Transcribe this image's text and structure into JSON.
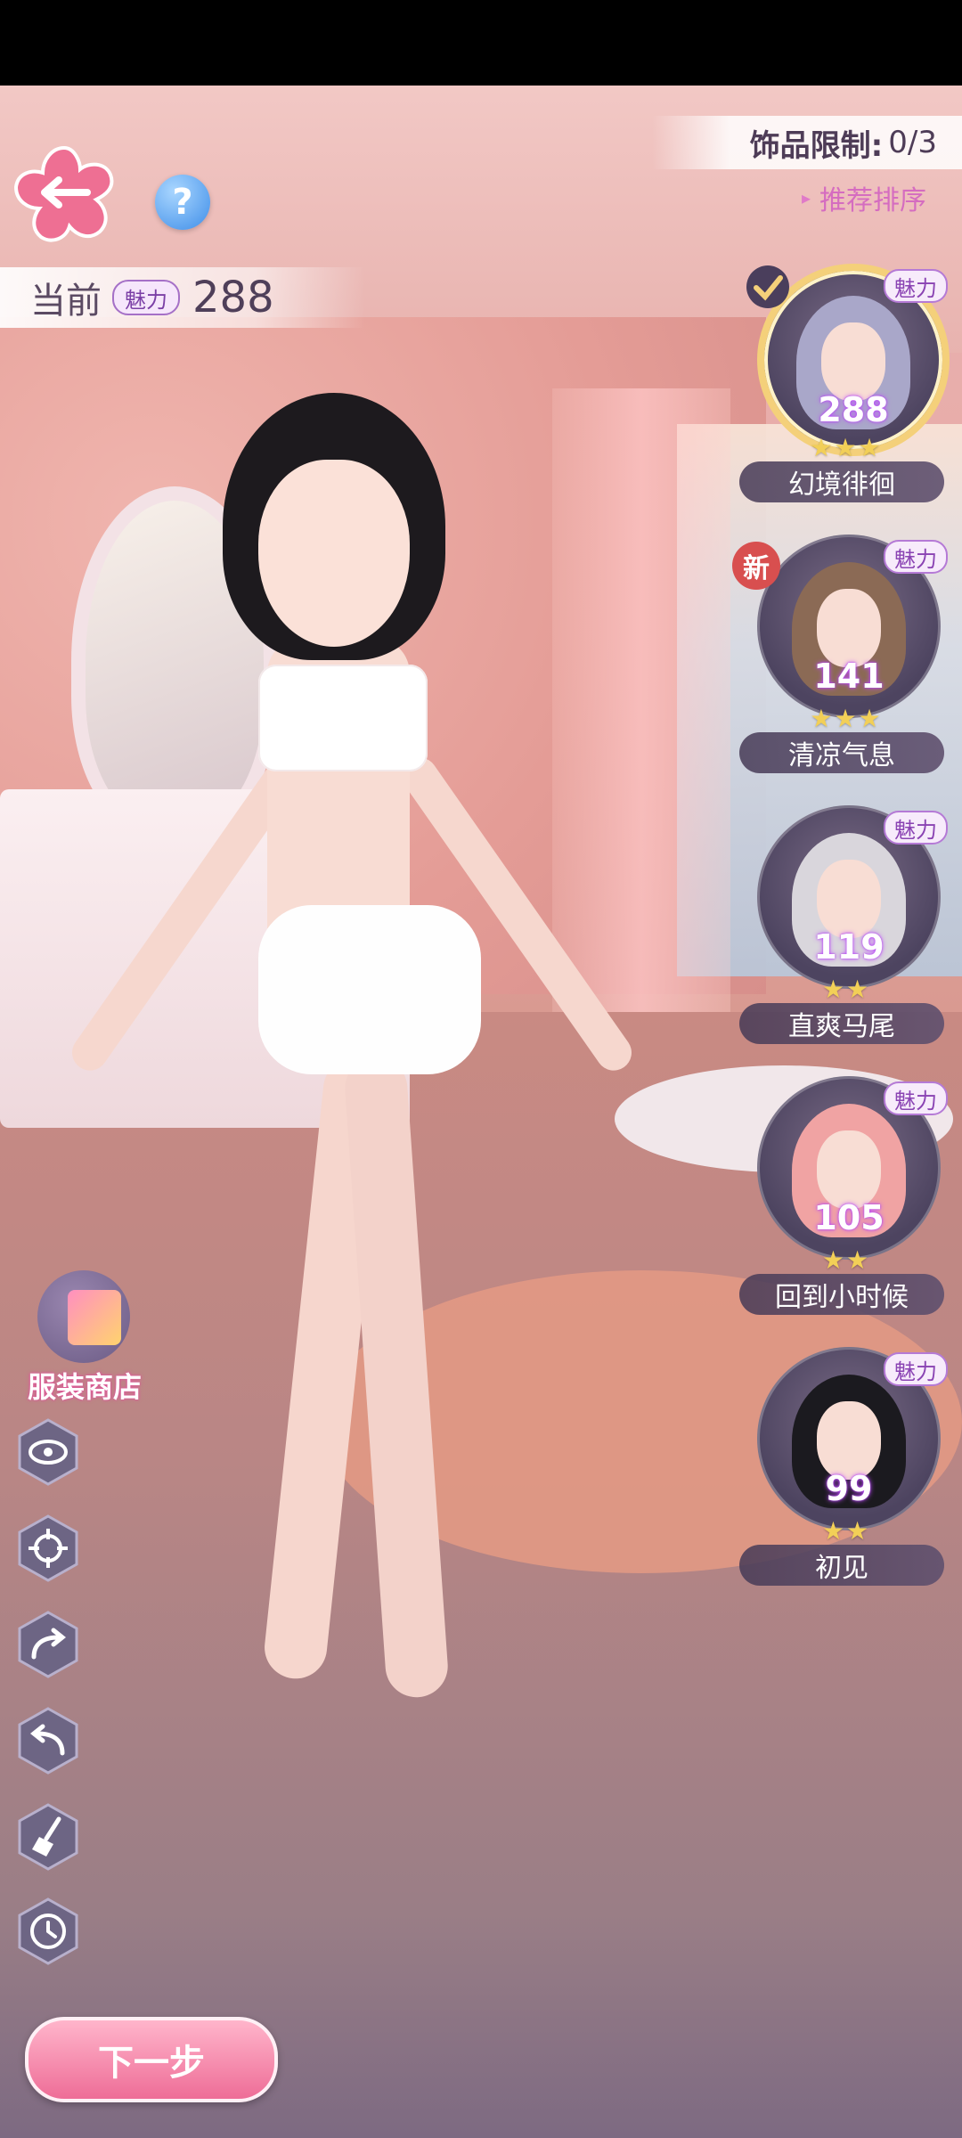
{
  "header": {
    "current_label": "当前",
    "charm_label": "魅力",
    "current_value": "288",
    "limit_label": "饰品限制:",
    "limit_value": "0/3",
    "sort_label": "推荐排序"
  },
  "hair_list": [
    {
      "name": "幻境徘徊",
      "score": "288",
      "charm": "魅力",
      "stars": "★★★",
      "selected": true,
      "hair_color": "#a9a7c9"
    },
    {
      "name": "清凉气息",
      "score": "141",
      "charm": "魅力",
      "stars": "★★★",
      "new": "新",
      "hair_color": "#8b6a55"
    },
    {
      "name": "直爽马尾",
      "score": "119",
      "charm": "魅力",
      "stars": "★★",
      "hair_color": "#d9d6dc"
    },
    {
      "name": "回到小时候",
      "score": "105",
      "charm": "魅力",
      "stars": "★★",
      "hair_color": "#f0a3a3"
    },
    {
      "name": "初见",
      "score": "99",
      "charm": "魅力",
      "stars": "★★",
      "hair_color": "#1b1a1f"
    }
  ],
  "tools": {
    "shop_label": "服装商店"
  },
  "footer": {
    "next_label": "下一步"
  },
  "colors": {
    "accent_pink": "#ee6d97",
    "charm_purple": "#a570c7",
    "star_gold": "#f2cf57"
  },
  "icons": [
    "back-arrow-icon",
    "help-icon",
    "eye-icon",
    "target-icon",
    "redo-icon",
    "undo-icon",
    "broom-icon",
    "history-icon",
    "check-icon"
  ]
}
